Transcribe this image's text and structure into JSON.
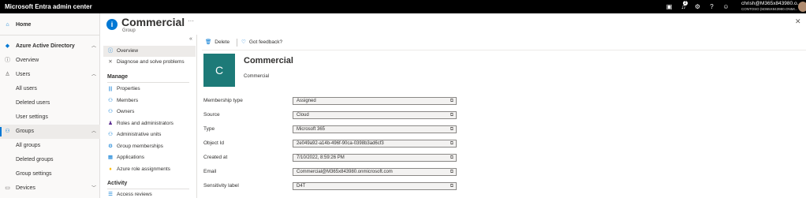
{
  "topbar": {
    "app_title": "Microsoft Entra admin center",
    "notification_count": "2",
    "user_name": "chrish@M365x843980.o...",
    "user_org": "CONTOSO (M365X843980.ONMI..."
  },
  "leftnav": {
    "home": "Home",
    "aad": "Azure Active Directory",
    "overview": "Overview",
    "users": "Users",
    "all_users": "All users",
    "deleted_users": "Deleted users",
    "user_settings": "User settings",
    "groups": "Groups",
    "all_groups": "All groups",
    "deleted_groups": "Deleted groups",
    "group_settings": "Group settings",
    "devices": "Devices"
  },
  "page": {
    "title": "Commercial",
    "subtitle": "Group"
  },
  "resource_menu": {
    "overview": "Overview",
    "diagnose": "Diagnose and solve problems",
    "manage_header": "Manage",
    "properties": "Properties",
    "members": "Members",
    "owners": "Owners",
    "roles": "Roles and administrators",
    "admin_units": "Administrative units",
    "group_memberships": "Group memberships",
    "applications": "Applications",
    "azure_roles": "Azure role assignments",
    "activity_header": "Activity",
    "access_reviews": "Access reviews"
  },
  "commands": {
    "delete": "Delete",
    "feedback": "Got feedback?"
  },
  "overview": {
    "avatar_letter": "C",
    "name": "Commercial",
    "description": "Commercial",
    "avatar_color": "#1d7a78"
  },
  "properties": [
    {
      "label": "Membership type",
      "value": "Assigned"
    },
    {
      "label": "Source",
      "value": "Cloud"
    },
    {
      "label": "Type",
      "value": "Microsoft 365"
    },
    {
      "label": "Object Id",
      "value": "2e049a92-a14b-496f-90ca-0398b3ad6cf3"
    },
    {
      "label": "Created at",
      "value": "7/10/2022, 8:59:26 PM"
    },
    {
      "label": "Email",
      "value": "Commercial@M365x843980.onmicrosoft.com"
    },
    {
      "label": "Sensitivity label",
      "value": "D4T"
    }
  ],
  "colors": {
    "accent": "#0078d4",
    "topbar": "#000000"
  }
}
